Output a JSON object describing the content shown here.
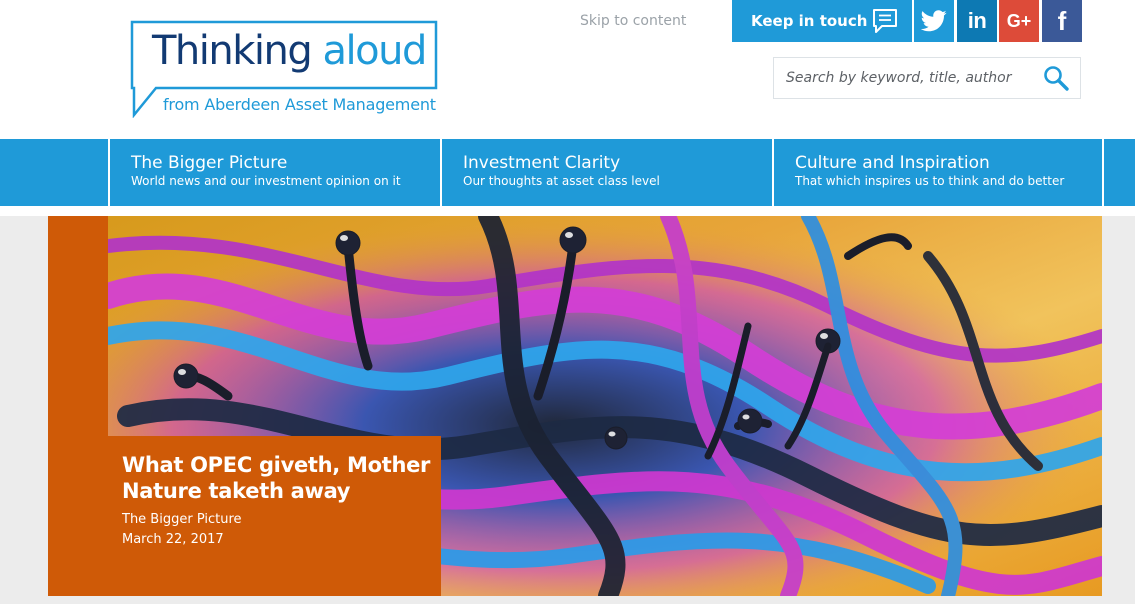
{
  "brand": {
    "title_word1": "Thinking",
    "title_word2": "aloud",
    "subtitle": "from Aberdeen Asset Management",
    "primary_color": "#1f9ad8",
    "dark_color": "#123a73",
    "accent_orange": "#cf5a07"
  },
  "header": {
    "skip_link": "Skip to content",
    "keep_in_touch": "Keep in touch",
    "keep_in_touch_icon": "speech-bubble-icon",
    "social": [
      {
        "name": "twitter",
        "glyph": "t",
        "icon": "twitter-icon",
        "color": "#1f9ad8"
      },
      {
        "name": "linkedin",
        "glyph": "in",
        "icon": "linkedin-icon",
        "color": "#0d79b3"
      },
      {
        "name": "google-plus",
        "glyph": "G+",
        "icon": "google-plus-icon",
        "color": "#dd4b39"
      },
      {
        "name": "facebook",
        "glyph": "f",
        "icon": "facebook-icon",
        "color": "#3b5998"
      }
    ],
    "search": {
      "placeholder": "Search by keyword, title, author",
      "value": "",
      "icon": "search-icon"
    }
  },
  "nav": {
    "items": [
      {
        "title": "The Bigger Picture",
        "subtitle": "World news and our investment opinion on it"
      },
      {
        "title": "Investment Clarity",
        "subtitle": "Our thoughts at asset class level"
      },
      {
        "title": "Culture and Inspiration",
        "subtitle": "That which inspires us to think and do better"
      }
    ]
  },
  "hero": {
    "title": "What OPEC giveth, Mother Nature taketh away",
    "category": "The Bigger Picture",
    "date": "March 22, 2017",
    "image_icon": "oil-splash-image"
  }
}
